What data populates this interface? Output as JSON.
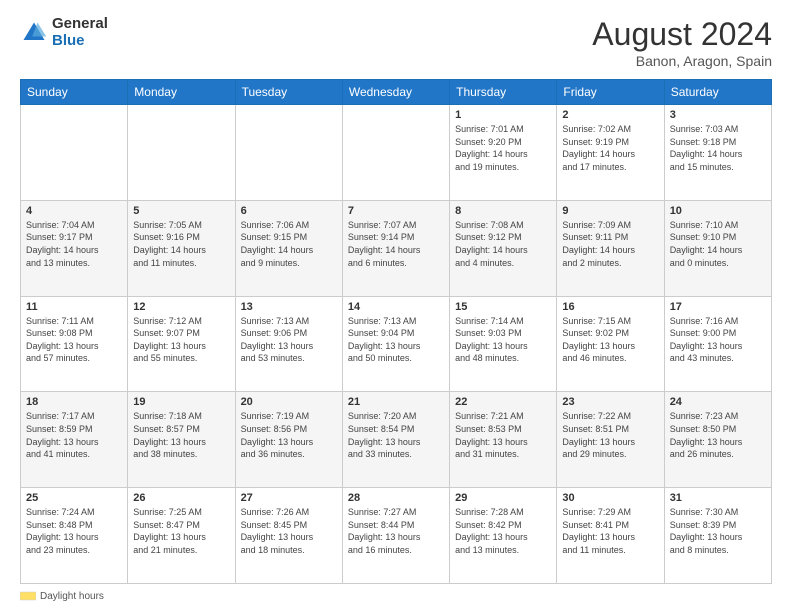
{
  "header": {
    "logo_general": "General",
    "logo_blue": "Blue",
    "month_title": "August 2024",
    "subtitle": "Banon, Aragon, Spain"
  },
  "weekdays": [
    "Sunday",
    "Monday",
    "Tuesday",
    "Wednesday",
    "Thursday",
    "Friday",
    "Saturday"
  ],
  "weeks": [
    [
      {
        "day": "",
        "info": ""
      },
      {
        "day": "",
        "info": ""
      },
      {
        "day": "",
        "info": ""
      },
      {
        "day": "",
        "info": ""
      },
      {
        "day": "1",
        "info": "Sunrise: 7:01 AM\nSunset: 9:20 PM\nDaylight: 14 hours\nand 19 minutes."
      },
      {
        "day": "2",
        "info": "Sunrise: 7:02 AM\nSunset: 9:19 PM\nDaylight: 14 hours\nand 17 minutes."
      },
      {
        "day": "3",
        "info": "Sunrise: 7:03 AM\nSunset: 9:18 PM\nDaylight: 14 hours\nand 15 minutes."
      }
    ],
    [
      {
        "day": "4",
        "info": "Sunrise: 7:04 AM\nSunset: 9:17 PM\nDaylight: 14 hours\nand 13 minutes."
      },
      {
        "day": "5",
        "info": "Sunrise: 7:05 AM\nSunset: 9:16 PM\nDaylight: 14 hours\nand 11 minutes."
      },
      {
        "day": "6",
        "info": "Sunrise: 7:06 AM\nSunset: 9:15 PM\nDaylight: 14 hours\nand 9 minutes."
      },
      {
        "day": "7",
        "info": "Sunrise: 7:07 AM\nSunset: 9:14 PM\nDaylight: 14 hours\nand 6 minutes."
      },
      {
        "day": "8",
        "info": "Sunrise: 7:08 AM\nSunset: 9:12 PM\nDaylight: 14 hours\nand 4 minutes."
      },
      {
        "day": "9",
        "info": "Sunrise: 7:09 AM\nSunset: 9:11 PM\nDaylight: 14 hours\nand 2 minutes."
      },
      {
        "day": "10",
        "info": "Sunrise: 7:10 AM\nSunset: 9:10 PM\nDaylight: 14 hours\nand 0 minutes."
      }
    ],
    [
      {
        "day": "11",
        "info": "Sunrise: 7:11 AM\nSunset: 9:08 PM\nDaylight: 13 hours\nand 57 minutes."
      },
      {
        "day": "12",
        "info": "Sunrise: 7:12 AM\nSunset: 9:07 PM\nDaylight: 13 hours\nand 55 minutes."
      },
      {
        "day": "13",
        "info": "Sunrise: 7:13 AM\nSunset: 9:06 PM\nDaylight: 13 hours\nand 53 minutes."
      },
      {
        "day": "14",
        "info": "Sunrise: 7:13 AM\nSunset: 9:04 PM\nDaylight: 13 hours\nand 50 minutes."
      },
      {
        "day": "15",
        "info": "Sunrise: 7:14 AM\nSunset: 9:03 PM\nDaylight: 13 hours\nand 48 minutes."
      },
      {
        "day": "16",
        "info": "Sunrise: 7:15 AM\nSunset: 9:02 PM\nDaylight: 13 hours\nand 46 minutes."
      },
      {
        "day": "17",
        "info": "Sunrise: 7:16 AM\nSunset: 9:00 PM\nDaylight: 13 hours\nand 43 minutes."
      }
    ],
    [
      {
        "day": "18",
        "info": "Sunrise: 7:17 AM\nSunset: 8:59 PM\nDaylight: 13 hours\nand 41 minutes."
      },
      {
        "day": "19",
        "info": "Sunrise: 7:18 AM\nSunset: 8:57 PM\nDaylight: 13 hours\nand 38 minutes."
      },
      {
        "day": "20",
        "info": "Sunrise: 7:19 AM\nSunset: 8:56 PM\nDaylight: 13 hours\nand 36 minutes."
      },
      {
        "day": "21",
        "info": "Sunrise: 7:20 AM\nSunset: 8:54 PM\nDaylight: 13 hours\nand 33 minutes."
      },
      {
        "day": "22",
        "info": "Sunrise: 7:21 AM\nSunset: 8:53 PM\nDaylight: 13 hours\nand 31 minutes."
      },
      {
        "day": "23",
        "info": "Sunrise: 7:22 AM\nSunset: 8:51 PM\nDaylight: 13 hours\nand 29 minutes."
      },
      {
        "day": "24",
        "info": "Sunrise: 7:23 AM\nSunset: 8:50 PM\nDaylight: 13 hours\nand 26 minutes."
      }
    ],
    [
      {
        "day": "25",
        "info": "Sunrise: 7:24 AM\nSunset: 8:48 PM\nDaylight: 13 hours\nand 23 minutes."
      },
      {
        "day": "26",
        "info": "Sunrise: 7:25 AM\nSunset: 8:47 PM\nDaylight: 13 hours\nand 21 minutes."
      },
      {
        "day": "27",
        "info": "Sunrise: 7:26 AM\nSunset: 8:45 PM\nDaylight: 13 hours\nand 18 minutes."
      },
      {
        "day": "28",
        "info": "Sunrise: 7:27 AM\nSunset: 8:44 PM\nDaylight: 13 hours\nand 16 minutes."
      },
      {
        "day": "29",
        "info": "Sunrise: 7:28 AM\nSunset: 8:42 PM\nDaylight: 13 hours\nand 13 minutes."
      },
      {
        "day": "30",
        "info": "Sunrise: 7:29 AM\nSunset: 8:41 PM\nDaylight: 13 hours\nand 11 minutes."
      },
      {
        "day": "31",
        "info": "Sunrise: 7:30 AM\nSunset: 8:39 PM\nDaylight: 13 hours\nand 8 minutes."
      }
    ]
  ],
  "footer": {
    "legend_label": "Daylight hours"
  }
}
